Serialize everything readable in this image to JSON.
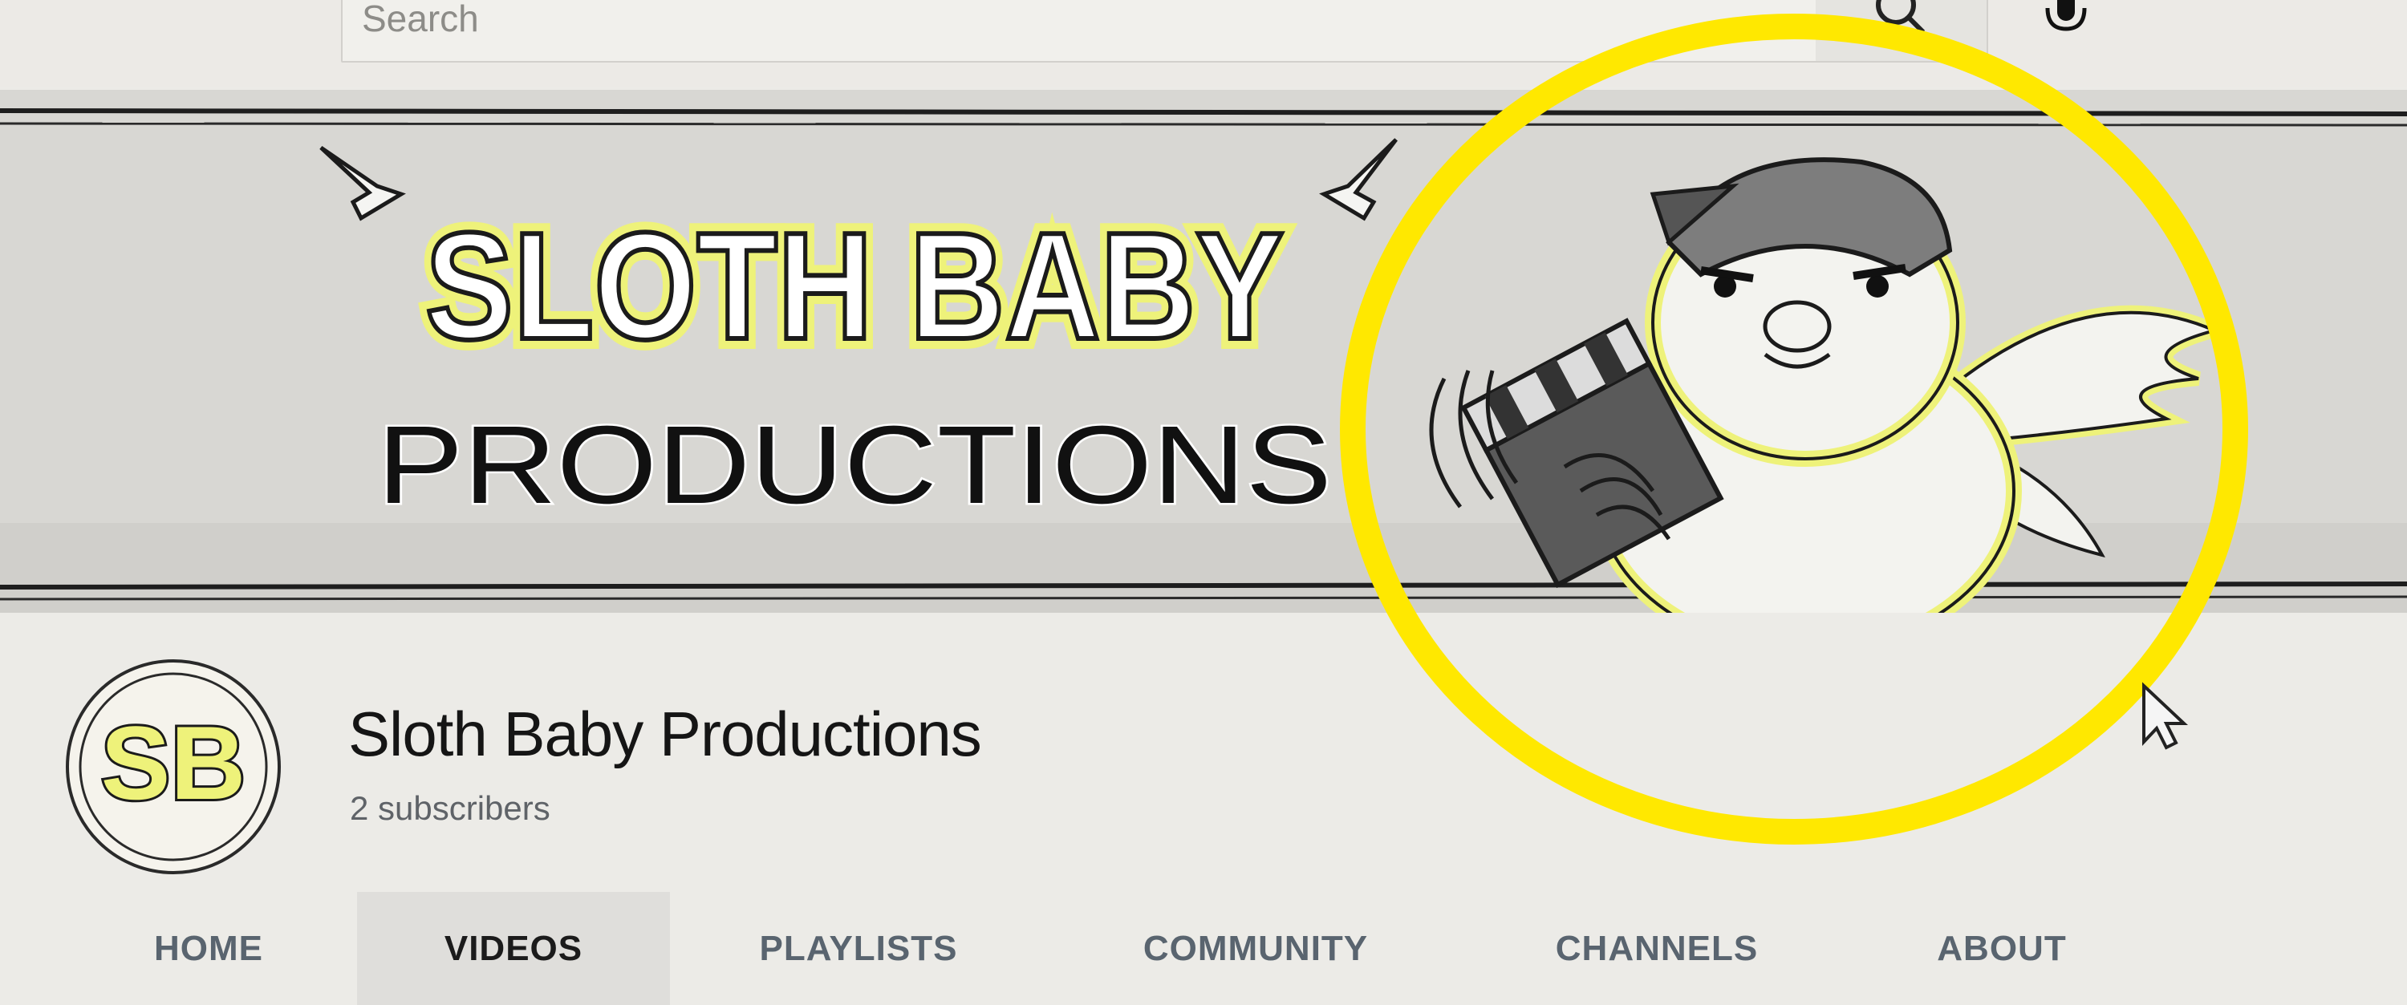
{
  "search": {
    "placeholder": "Search"
  },
  "icons": {
    "search": "search-icon",
    "mic": "microphone-icon",
    "cursor": "mouse-pointer-icon"
  },
  "banner": {
    "title_line1": "SLOTH BABY",
    "title_line2": "PRODUCTIONS"
  },
  "avatar": {
    "initials": "SB"
  },
  "channel": {
    "name": "Sloth Baby Productions",
    "subscribers": "2 subscribers"
  },
  "tabs": [
    {
      "label": "HOME"
    },
    {
      "label": "VIDEOS",
      "active": true
    },
    {
      "label": "PLAYLISTS"
    },
    {
      "label": "COMMUNITY"
    },
    {
      "label": "CHANNELS"
    },
    {
      "label": "ABOUT"
    }
  ],
  "colors": {
    "accent_yellow": "#ffe800",
    "banner_yellow": "#eef27a",
    "text_dark": "#151515",
    "text_muted": "#5f6368"
  }
}
